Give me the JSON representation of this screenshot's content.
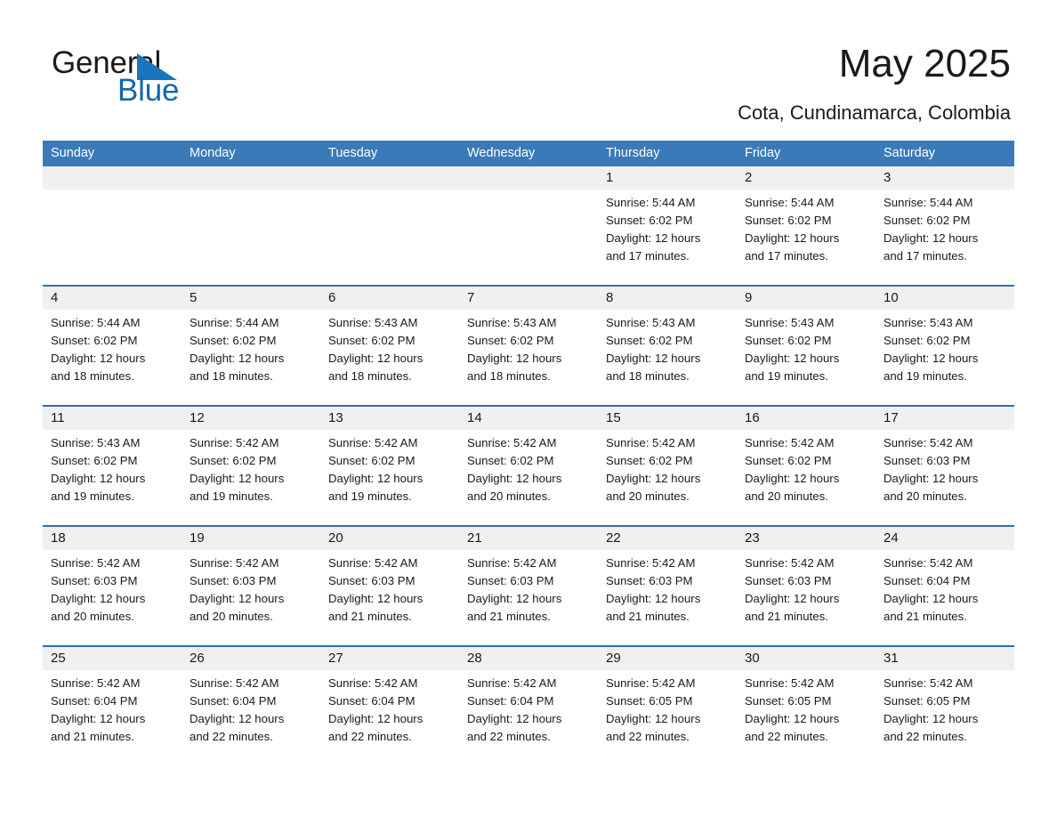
{
  "brand": {
    "name_part1": "General",
    "name_part2": "Blue",
    "triangle_color": "#1a75bb",
    "blue_color": "#1167b1"
  },
  "header": {
    "title": "May 2025",
    "subtitle": "Cota, Cundinamarca, Colombia"
  },
  "theme": {
    "header_blue": "#3b7ab8",
    "week_rule_blue": "#2f6fae",
    "daynum_band": "#f0f0f0"
  },
  "weekdays": [
    "Sunday",
    "Monday",
    "Tuesday",
    "Wednesday",
    "Thursday",
    "Friday",
    "Saturday"
  ],
  "weeks": [
    [
      {
        "day": "",
        "sunrise": "",
        "sunset": "",
        "daylight1": "",
        "daylight2": ""
      },
      {
        "day": "",
        "sunrise": "",
        "sunset": "",
        "daylight1": "",
        "daylight2": ""
      },
      {
        "day": "",
        "sunrise": "",
        "sunset": "",
        "daylight1": "",
        "daylight2": ""
      },
      {
        "day": "",
        "sunrise": "",
        "sunset": "",
        "daylight1": "",
        "daylight2": ""
      },
      {
        "day": "1",
        "sunrise": "Sunrise: 5:44 AM",
        "sunset": "Sunset: 6:02 PM",
        "daylight1": "Daylight: 12 hours",
        "daylight2": "and 17 minutes."
      },
      {
        "day": "2",
        "sunrise": "Sunrise: 5:44 AM",
        "sunset": "Sunset: 6:02 PM",
        "daylight1": "Daylight: 12 hours",
        "daylight2": "and 17 minutes."
      },
      {
        "day": "3",
        "sunrise": "Sunrise: 5:44 AM",
        "sunset": "Sunset: 6:02 PM",
        "daylight1": "Daylight: 12 hours",
        "daylight2": "and 17 minutes."
      }
    ],
    [
      {
        "day": "4",
        "sunrise": "Sunrise: 5:44 AM",
        "sunset": "Sunset: 6:02 PM",
        "daylight1": "Daylight: 12 hours",
        "daylight2": "and 18 minutes."
      },
      {
        "day": "5",
        "sunrise": "Sunrise: 5:44 AM",
        "sunset": "Sunset: 6:02 PM",
        "daylight1": "Daylight: 12 hours",
        "daylight2": "and 18 minutes."
      },
      {
        "day": "6",
        "sunrise": "Sunrise: 5:43 AM",
        "sunset": "Sunset: 6:02 PM",
        "daylight1": "Daylight: 12 hours",
        "daylight2": "and 18 minutes."
      },
      {
        "day": "7",
        "sunrise": "Sunrise: 5:43 AM",
        "sunset": "Sunset: 6:02 PM",
        "daylight1": "Daylight: 12 hours",
        "daylight2": "and 18 minutes."
      },
      {
        "day": "8",
        "sunrise": "Sunrise: 5:43 AM",
        "sunset": "Sunset: 6:02 PM",
        "daylight1": "Daylight: 12 hours",
        "daylight2": "and 18 minutes."
      },
      {
        "day": "9",
        "sunrise": "Sunrise: 5:43 AM",
        "sunset": "Sunset: 6:02 PM",
        "daylight1": "Daylight: 12 hours",
        "daylight2": "and 19 minutes."
      },
      {
        "day": "10",
        "sunrise": "Sunrise: 5:43 AM",
        "sunset": "Sunset: 6:02 PM",
        "daylight1": "Daylight: 12 hours",
        "daylight2": "and 19 minutes."
      }
    ],
    [
      {
        "day": "11",
        "sunrise": "Sunrise: 5:43 AM",
        "sunset": "Sunset: 6:02 PM",
        "daylight1": "Daylight: 12 hours",
        "daylight2": "and 19 minutes."
      },
      {
        "day": "12",
        "sunrise": "Sunrise: 5:42 AM",
        "sunset": "Sunset: 6:02 PM",
        "daylight1": "Daylight: 12 hours",
        "daylight2": "and 19 minutes."
      },
      {
        "day": "13",
        "sunrise": "Sunrise: 5:42 AM",
        "sunset": "Sunset: 6:02 PM",
        "daylight1": "Daylight: 12 hours",
        "daylight2": "and 19 minutes."
      },
      {
        "day": "14",
        "sunrise": "Sunrise: 5:42 AM",
        "sunset": "Sunset: 6:02 PM",
        "daylight1": "Daylight: 12 hours",
        "daylight2": "and 20 minutes."
      },
      {
        "day": "15",
        "sunrise": "Sunrise: 5:42 AM",
        "sunset": "Sunset: 6:02 PM",
        "daylight1": "Daylight: 12 hours",
        "daylight2": "and 20 minutes."
      },
      {
        "day": "16",
        "sunrise": "Sunrise: 5:42 AM",
        "sunset": "Sunset: 6:02 PM",
        "daylight1": "Daylight: 12 hours",
        "daylight2": "and 20 minutes."
      },
      {
        "day": "17",
        "sunrise": "Sunrise: 5:42 AM",
        "sunset": "Sunset: 6:03 PM",
        "daylight1": "Daylight: 12 hours",
        "daylight2": "and 20 minutes."
      }
    ],
    [
      {
        "day": "18",
        "sunrise": "Sunrise: 5:42 AM",
        "sunset": "Sunset: 6:03 PM",
        "daylight1": "Daylight: 12 hours",
        "daylight2": "and 20 minutes."
      },
      {
        "day": "19",
        "sunrise": "Sunrise: 5:42 AM",
        "sunset": "Sunset: 6:03 PM",
        "daylight1": "Daylight: 12 hours",
        "daylight2": "and 20 minutes."
      },
      {
        "day": "20",
        "sunrise": "Sunrise: 5:42 AM",
        "sunset": "Sunset: 6:03 PM",
        "daylight1": "Daylight: 12 hours",
        "daylight2": "and 21 minutes."
      },
      {
        "day": "21",
        "sunrise": "Sunrise: 5:42 AM",
        "sunset": "Sunset: 6:03 PM",
        "daylight1": "Daylight: 12 hours",
        "daylight2": "and 21 minutes."
      },
      {
        "day": "22",
        "sunrise": "Sunrise: 5:42 AM",
        "sunset": "Sunset: 6:03 PM",
        "daylight1": "Daylight: 12 hours",
        "daylight2": "and 21 minutes."
      },
      {
        "day": "23",
        "sunrise": "Sunrise: 5:42 AM",
        "sunset": "Sunset: 6:03 PM",
        "daylight1": "Daylight: 12 hours",
        "daylight2": "and 21 minutes."
      },
      {
        "day": "24",
        "sunrise": "Sunrise: 5:42 AM",
        "sunset": "Sunset: 6:04 PM",
        "daylight1": "Daylight: 12 hours",
        "daylight2": "and 21 minutes."
      }
    ],
    [
      {
        "day": "25",
        "sunrise": "Sunrise: 5:42 AM",
        "sunset": "Sunset: 6:04 PM",
        "daylight1": "Daylight: 12 hours",
        "daylight2": "and 21 minutes."
      },
      {
        "day": "26",
        "sunrise": "Sunrise: 5:42 AM",
        "sunset": "Sunset: 6:04 PM",
        "daylight1": "Daylight: 12 hours",
        "daylight2": "and 22 minutes."
      },
      {
        "day": "27",
        "sunrise": "Sunrise: 5:42 AM",
        "sunset": "Sunset: 6:04 PM",
        "daylight1": "Daylight: 12 hours",
        "daylight2": "and 22 minutes."
      },
      {
        "day": "28",
        "sunrise": "Sunrise: 5:42 AM",
        "sunset": "Sunset: 6:04 PM",
        "daylight1": "Daylight: 12 hours",
        "daylight2": "and 22 minutes."
      },
      {
        "day": "29",
        "sunrise": "Sunrise: 5:42 AM",
        "sunset": "Sunset: 6:05 PM",
        "daylight1": "Daylight: 12 hours",
        "daylight2": "and 22 minutes."
      },
      {
        "day": "30",
        "sunrise": "Sunrise: 5:42 AM",
        "sunset": "Sunset: 6:05 PM",
        "daylight1": "Daylight: 12 hours",
        "daylight2": "and 22 minutes."
      },
      {
        "day": "31",
        "sunrise": "Sunrise: 5:42 AM",
        "sunset": "Sunset: 6:05 PM",
        "daylight1": "Daylight: 12 hours",
        "daylight2": "and 22 minutes."
      }
    ]
  ]
}
